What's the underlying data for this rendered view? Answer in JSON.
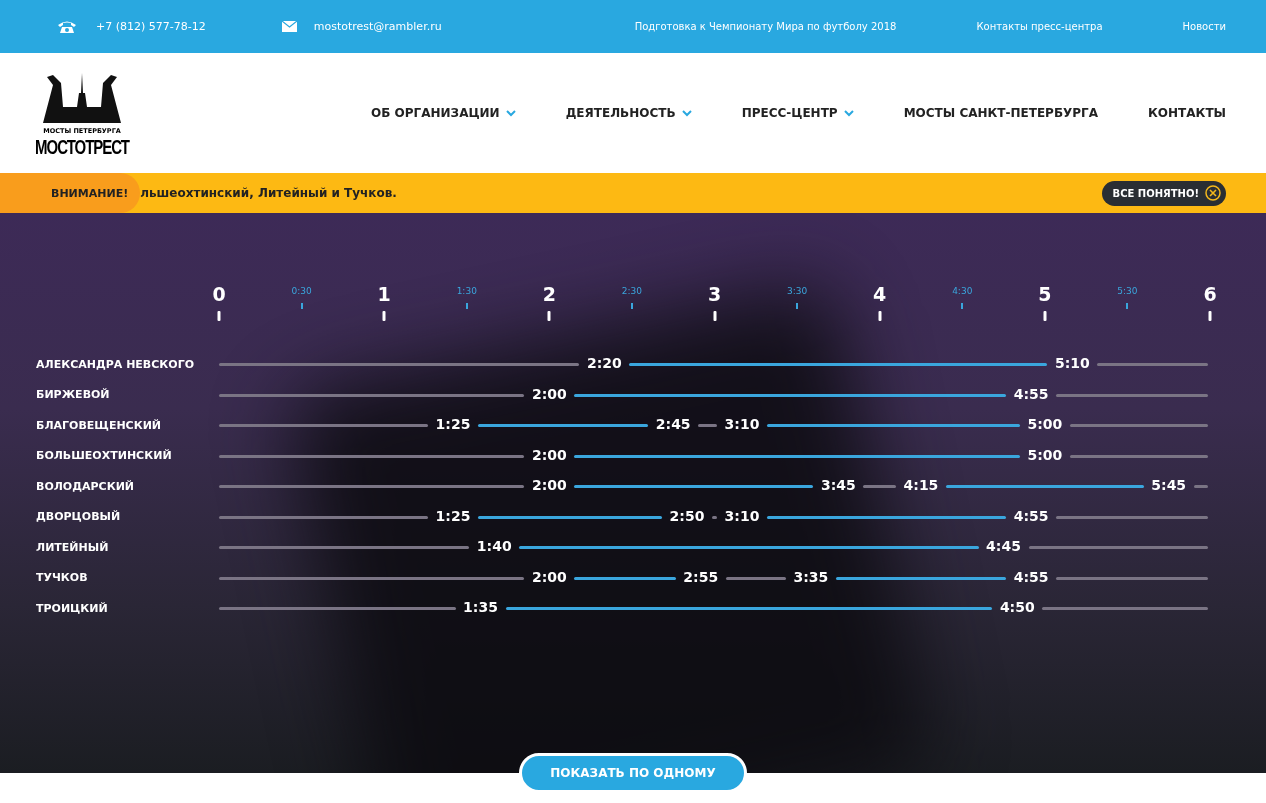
{
  "top_bar": {
    "phone": "+7 (812) 577-78-12",
    "email": "mostotrest@rambler.ru",
    "links": [
      "Подготовка к Чемпионату Мира по футболу 2018",
      "Контакты пресс-центра",
      "Новости"
    ]
  },
  "logo": {
    "caption": "МОСТЫ ПЕТЕРБУРГА",
    "name": "МОСТОТРЕСТ"
  },
  "nav": [
    {
      "label": "ОБ ОРГАНИЗАЦИИ",
      "dropdown": true
    },
    {
      "label": "ДЕЯТЕЛЬНОСТЬ",
      "dropdown": true
    },
    {
      "label": "ПРЕСС-ЦЕНТР",
      "dropdown": true
    },
    {
      "label": "МОСТЫ САНКТ-ПЕТЕРБУРГА",
      "dropdown": false
    },
    {
      "label": "КОНТАКТЫ",
      "dropdown": false
    }
  ],
  "alert": {
    "badge": "ВНИМАНИЕ!",
    "text": "льшеохтинский, Литейный и Тучков.",
    "button": "ВСЕ ПОНЯТНО!"
  },
  "axis": {
    "hours": [
      "0",
      "1",
      "2",
      "3",
      "4",
      "5",
      "6"
    ],
    "half_hours": [
      "0:30",
      "1:30",
      "2:30",
      "3:30",
      "4:30",
      "5:30"
    ]
  },
  "bridges": [
    {
      "name": "АЛЕКСАНДРА НЕВСКОГО",
      "times": [
        "2:20",
        "5:10"
      ]
    },
    {
      "name": "БИРЖЕВОЙ",
      "times": [
        "2:00",
        "4:55"
      ]
    },
    {
      "name": "БЛАГОВЕЩЕНСКИЙ",
      "times": [
        "1:25",
        "2:45",
        "3:10",
        "5:00"
      ]
    },
    {
      "name": "БОЛЬШЕОХТИНСКИЙ",
      "times": [
        "2:00",
        "5:00"
      ]
    },
    {
      "name": "ВОЛОДАРСКИЙ",
      "times": [
        "2:00",
        "3:45",
        "4:15",
        "5:45"
      ]
    },
    {
      "name": "ДВОРЦОВЫЙ",
      "times": [
        "1:25",
        "2:50",
        "3:10",
        "4:55"
      ]
    },
    {
      "name": "ЛИТЕЙНЫЙ",
      "times": [
        "1:40",
        "4:45"
      ]
    },
    {
      "name": "ТУЧКОВ",
      "times": [
        "2:00",
        "2:55",
        "3:35",
        "4:55"
      ]
    },
    {
      "name": "ТРОИЦКИЙ",
      "times": [
        "1:35",
        "4:50"
      ]
    }
  ],
  "show_one_button": "ПОКАЗАТЬ ПО ОДНОМУ"
}
